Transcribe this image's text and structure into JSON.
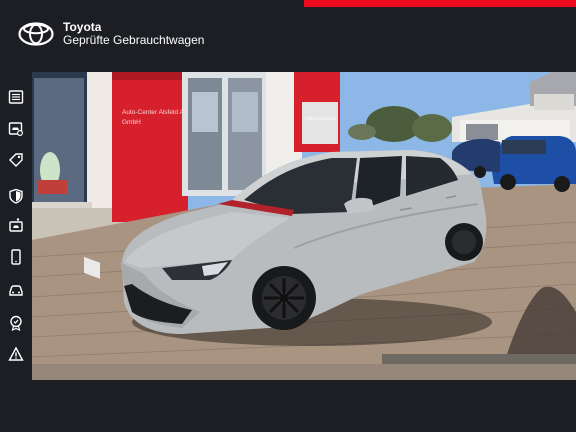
{
  "header": {
    "brand_name": "Toyota",
    "subtitle": "Geprüfte Gebrauchtwagen",
    "accent_color": "#eb0a1e",
    "logo_icon": "toyota-logo"
  },
  "sidebar": {
    "items": [
      {
        "icon": "list-icon"
      },
      {
        "icon": "car-search-icon"
      },
      {
        "icon": "price-tag-icon"
      },
      {
        "icon": "shield-icon"
      },
      {
        "icon": "car-wash-icon"
      },
      {
        "icon": "smartphone-icon"
      },
      {
        "icon": "car-front-icon"
      },
      {
        "icon": "award-icon"
      },
      {
        "icon": "warning-icon"
      }
    ]
  },
  "photo": {
    "dealer_sign": "Auto-Center Alsfeld AH GmbH",
    "hours_sign": "Öffnungszeiten"
  }
}
